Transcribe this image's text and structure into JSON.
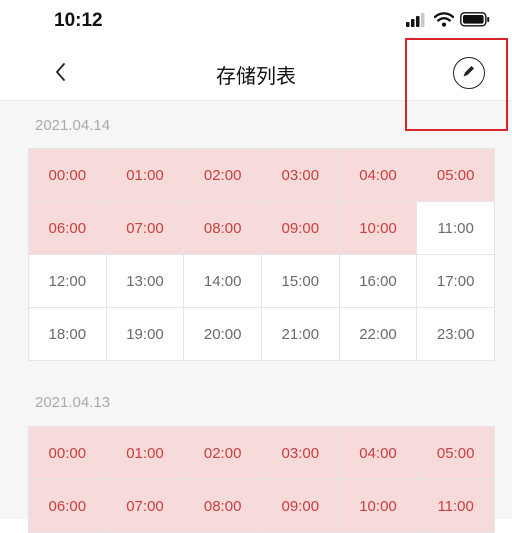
{
  "status_bar": {
    "time": "10:12",
    "icons": [
      "signal-icon",
      "wifi-icon",
      "battery-icon"
    ]
  },
  "nav": {
    "title": "存储列表",
    "back_icon": "chevron-left-icon",
    "edit_icon": "pencil-icon"
  },
  "colors": {
    "recorded_bg": "#f7dada",
    "recorded_text": "#c93f3f",
    "highlight_border": "#d9252a"
  },
  "days": [
    {
      "date": "2021.04.14",
      "hours": [
        {
          "t": "00:00",
          "r": true
        },
        {
          "t": "01:00",
          "r": true
        },
        {
          "t": "02:00",
          "r": true
        },
        {
          "t": "03:00",
          "r": true
        },
        {
          "t": "04:00",
          "r": true
        },
        {
          "t": "05:00",
          "r": true
        },
        {
          "t": "06:00",
          "r": true
        },
        {
          "t": "07:00",
          "r": true
        },
        {
          "t": "08:00",
          "r": true
        },
        {
          "t": "09:00",
          "r": true
        },
        {
          "t": "10:00",
          "r": true
        },
        {
          "t": "11:00",
          "r": false
        },
        {
          "t": "12:00",
          "r": false
        },
        {
          "t": "13:00",
          "r": false
        },
        {
          "t": "14:00",
          "r": false
        },
        {
          "t": "15:00",
          "r": false
        },
        {
          "t": "16:00",
          "r": false
        },
        {
          "t": "17:00",
          "r": false
        },
        {
          "t": "18:00",
          "r": false
        },
        {
          "t": "19:00",
          "r": false
        },
        {
          "t": "20:00",
          "r": false
        },
        {
          "t": "21:00",
          "r": false
        },
        {
          "t": "22:00",
          "r": false
        },
        {
          "t": "23:00",
          "r": false
        }
      ]
    },
    {
      "date": "2021.04.13",
      "hours": [
        {
          "t": "00:00",
          "r": true
        },
        {
          "t": "01:00",
          "r": true
        },
        {
          "t": "02:00",
          "r": true
        },
        {
          "t": "03:00",
          "r": true
        },
        {
          "t": "04:00",
          "r": true
        },
        {
          "t": "05:00",
          "r": true
        },
        {
          "t": "06:00",
          "r": true
        },
        {
          "t": "07:00",
          "r": true
        },
        {
          "t": "08:00",
          "r": true
        },
        {
          "t": "09:00",
          "r": true
        },
        {
          "t": "10:00",
          "r": true
        },
        {
          "t": "11:00",
          "r": true
        }
      ]
    }
  ]
}
